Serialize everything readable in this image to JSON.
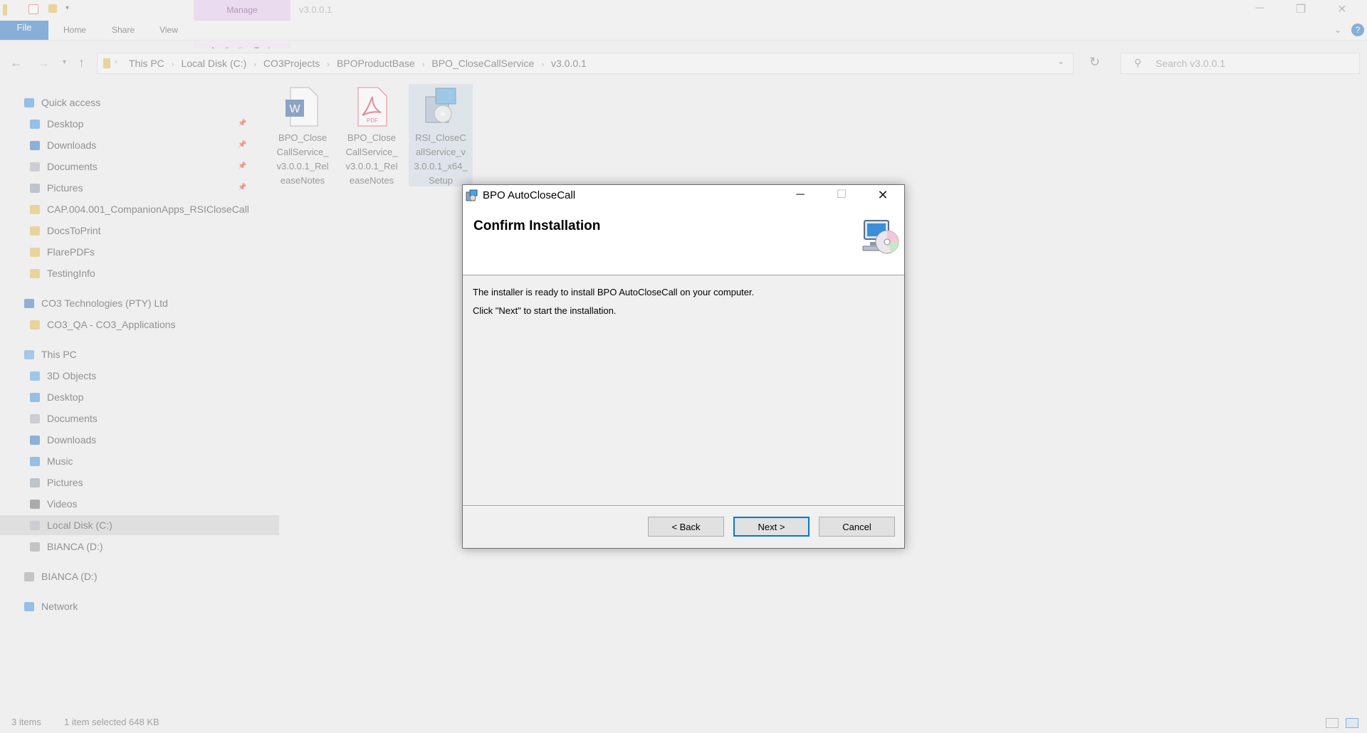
{
  "explorer": {
    "window_title": "v3.0.0.1",
    "ribbon": {
      "file_tab": "File",
      "tabs": [
        "Home",
        "Share",
        "View"
      ],
      "contextual_group": "Manage",
      "contextual_tab": "Application Tools"
    },
    "breadcrumb": [
      "This PC",
      "Local Disk (C:)",
      "CO3Projects",
      "BPOProductBase",
      "BPO_CloseCallService",
      "v3.0.0.1"
    ],
    "search_placeholder": "Search v3.0.0.1",
    "nav": {
      "quick_access": "Quick access",
      "quick_items": [
        "Desktop",
        "Downloads",
        "Documents",
        "Pictures",
        "CAP.004.001_CompanionApps_RSICloseCall",
        "DocsToPrint",
        "FlarePDFs",
        "TestingInfo"
      ],
      "org": "CO3 Technologies (PTY) Ltd",
      "org_items": [
        "CO3_QA - CO3_Applications"
      ],
      "this_pc": "This PC",
      "pc_items": [
        "3D Objects",
        "Desktop",
        "Documents",
        "Downloads",
        "Music",
        "Pictures",
        "Videos",
        "Local Disk (C:)",
        "BIANCA (D:)"
      ],
      "drive": "BIANCA (D:)",
      "network": "Network"
    },
    "files": [
      {
        "name_lines": [
          "BPO_Close",
          "CallService_",
          "v3.0.0.1_Rel",
          "easeNotes"
        ],
        "type": "word"
      },
      {
        "name_lines": [
          "BPO_Close",
          "CallService_",
          "v3.0.0.1_Rel",
          "easeNotes"
        ],
        "type": "pdf"
      },
      {
        "name_lines": [
          "RSI_CloseC",
          "allService_v",
          "3.0.0.1_x64_",
          "Setup"
        ],
        "type": "setup"
      }
    ],
    "status": {
      "items": "3 items",
      "selection": "1 item selected  648 KB"
    }
  },
  "dialog": {
    "title": "BPO AutoCloseCall",
    "heading": "Confirm Installation",
    "message1": "The installer is ready to install BPO AutoCloseCall on your computer.",
    "message2": "Click \"Next\" to start the installation.",
    "back_label": "< Back",
    "next_label": "Next >",
    "cancel_label": "Cancel"
  },
  "colors": {
    "accent": "#0078d7",
    "file_tab": "#1e6fbf",
    "manage": "#e6c6ec"
  }
}
